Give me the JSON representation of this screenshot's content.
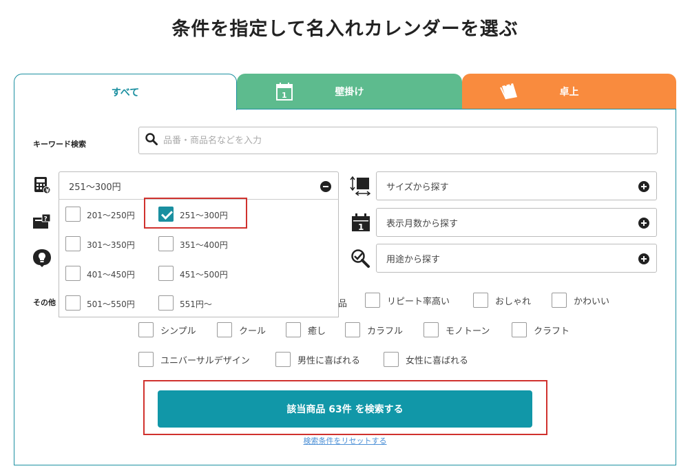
{
  "page_title": "条件を指定して名入れカレンダーを選ぶ",
  "tabs": [
    {
      "label": "すべて",
      "active": true
    },
    {
      "label": "壁掛け",
      "active": false
    },
    {
      "label": "卓上",
      "active": false
    }
  ],
  "tab_icons": {
    "wall": "wall-calendar-icon",
    "desk": "desk-calendar-icon"
  },
  "keyword": {
    "label": "キーワード検索",
    "placeholder": "品番・商品名などを入力",
    "value": ""
  },
  "price": {
    "selected": "251〜300円",
    "options": [
      "201〜250円",
      "251〜300円",
      "301〜350円",
      "351〜400円",
      "401〜450円",
      "451〜500円",
      "501〜550円",
      "551円〜"
    ],
    "checked_index": 1
  },
  "selects": {
    "size": "サイズから探す",
    "months": "表示月数から探す",
    "usage": "用途から探す"
  },
  "misc": {
    "label": "その他",
    "hidden_partial": "品",
    "options": [
      "リピート率高い",
      "おしゃれ",
      "かわいい",
      "シンプル",
      "クール",
      "癒し",
      "カラフル",
      "モノトーン",
      "クラフト",
      "ユニバーサルデザイン",
      "男性に喜ばれる",
      "女性に喜ばれる"
    ]
  },
  "search_button": "該当商品 63件 を検索する",
  "reset_link": "検索条件をリセットする",
  "colors": {
    "accent": "#1197a8",
    "wall_tab": "#5dbb8e",
    "desk_tab": "#f98b3e",
    "highlight": "#d0312d"
  }
}
